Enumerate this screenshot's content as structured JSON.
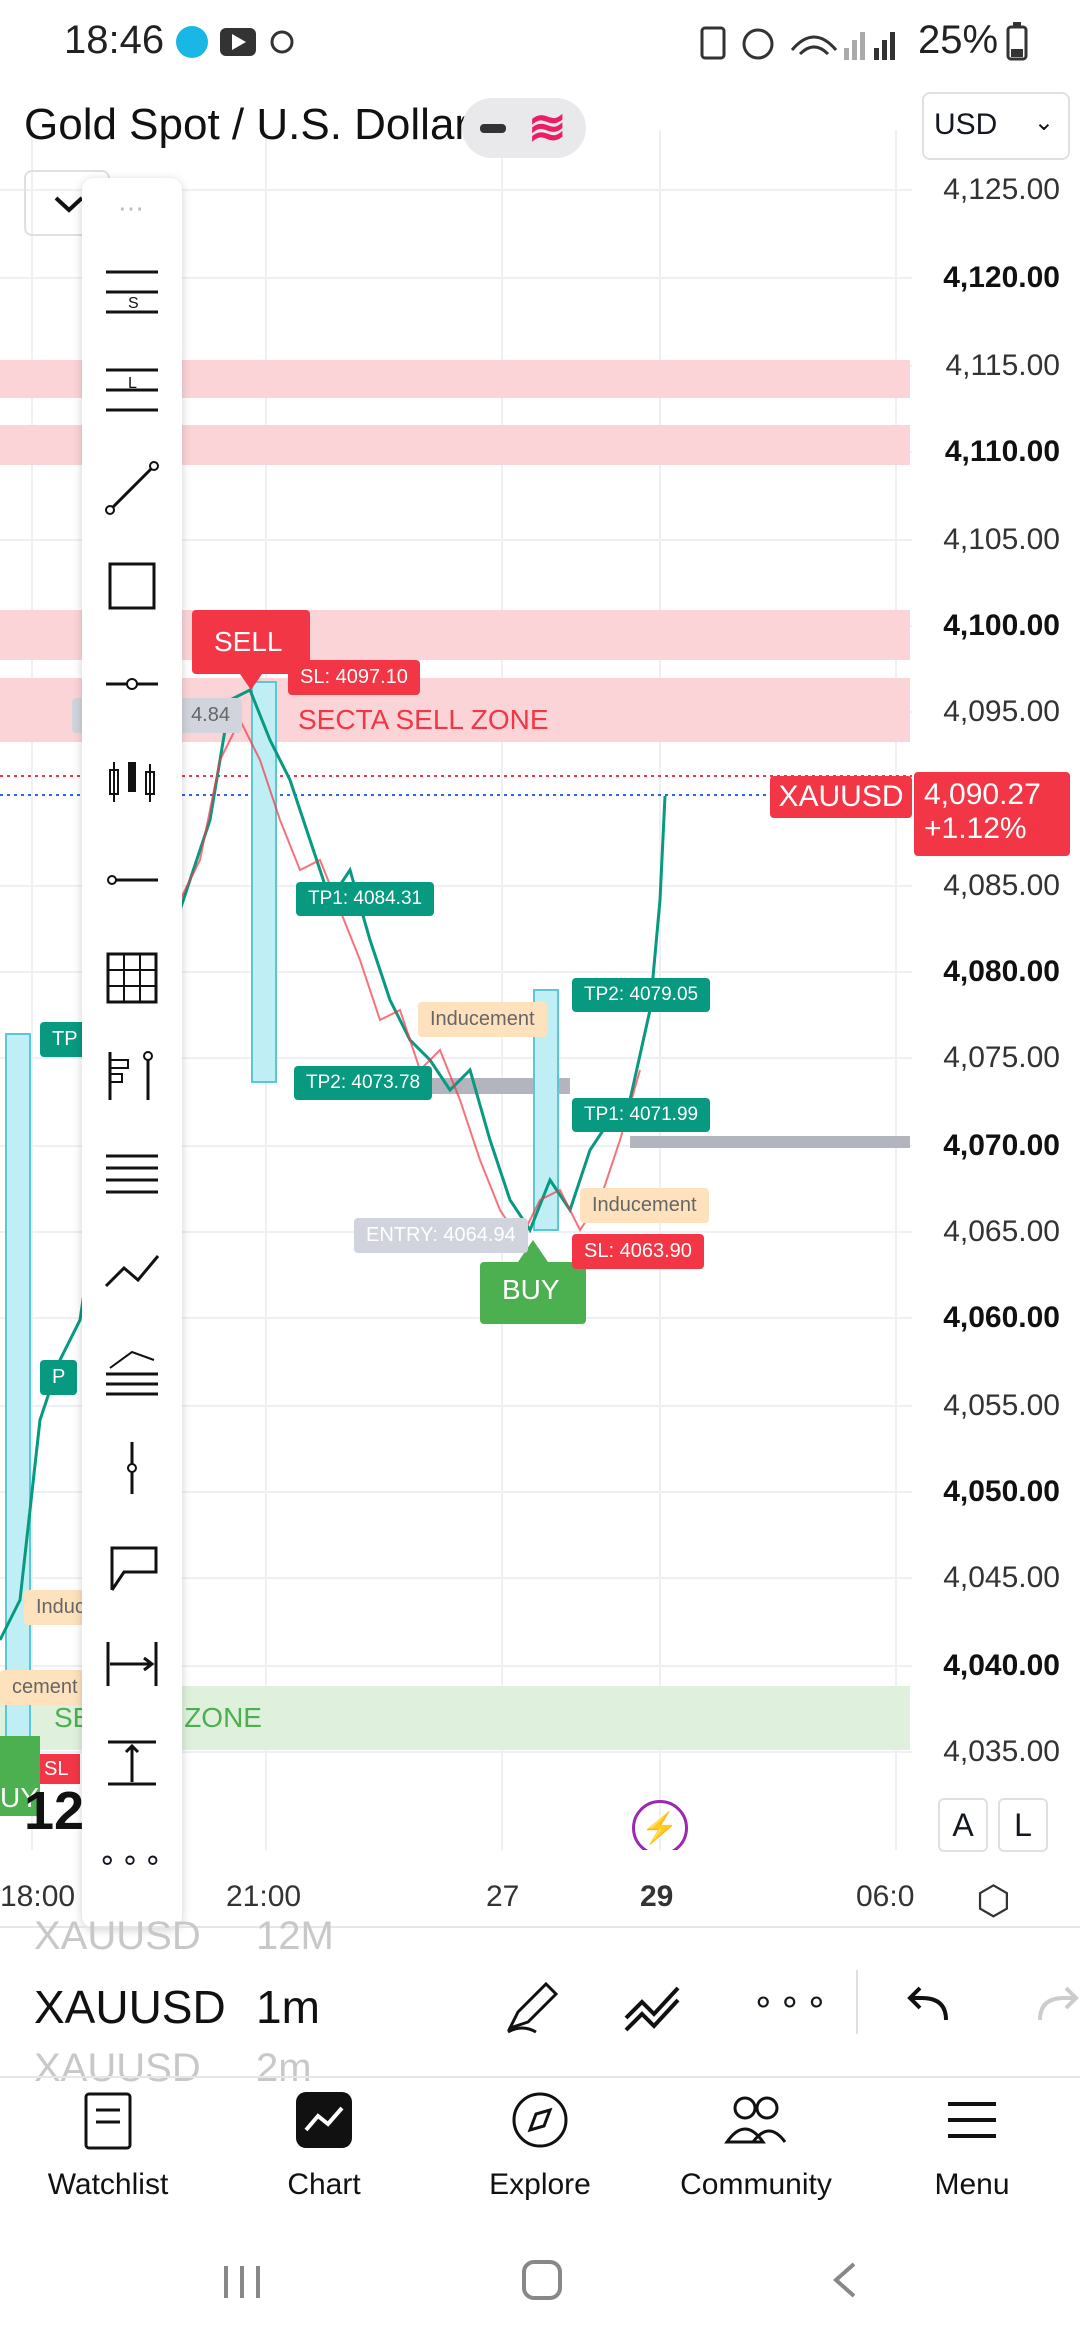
{
  "status_bar": {
    "time": "18:46",
    "battery": "25%"
  },
  "header": {
    "symbol_title": "Gold Spot / U.S. Dollar",
    "currency": "USD"
  },
  "price_axis": {
    "labels": [
      "4,125.00",
      "4,120.00",
      "4,115.00",
      "4,110.00",
      "4,105.00",
      "4,100.00",
      "4,095.00",
      "4,085.00",
      "4,080.00",
      "4,075.00",
      "4,070.00",
      "4,065.00",
      "4,060.00",
      "4,055.00",
      "4,050.00",
      "4,045.00",
      "4,040.00",
      "4,035.00"
    ],
    "current_price": "4,090.27",
    "change": "+1.12%",
    "ticker_tag": "XAUUSD",
    "scale_buttons": [
      "A",
      "L"
    ]
  },
  "time_axis": {
    "labels": [
      "18:00",
      "21:00",
      "27",
      "29",
      "06:0"
    ]
  },
  "chart_annotations": {
    "sell_label": "SELL",
    "buy_label": "BUY",
    "sl_sell": "SL: 4097.10",
    "tp1_sell": "TP1: 4084.31",
    "tp2_sell": "TP2: 4073.78",
    "sell_entry_partial": "4.84",
    "sell_zone": "SECTA SELL ZONE",
    "buy_zone": "SE      UY ZONE",
    "tp2_buy": "TP2: 4079.05",
    "tp1_buy": "TP1: 4071.99",
    "sl_buy": "SL: 4063.90",
    "entry_buy": "ENTRY: 4064.94",
    "inducement_1": "Inducement",
    "inducement_2": "Inducement",
    "inducement_left": "Induce",
    "inducement_left2": "cement",
    "left_tp": "TP",
    "left_p": "P",
    "left_sl": "SL",
    "left_buy": "UY",
    "left_big": "12"
  },
  "bottom_bar": {
    "symbol_prev": "XAUUSD",
    "interval_prev": "12M",
    "symbol": "XAUUSD",
    "interval": "1m",
    "symbol_next": "XAUUSD",
    "interval_next": "2m"
  },
  "nav": {
    "items": [
      {
        "label": "Watchlist"
      },
      {
        "label": "Chart"
      },
      {
        "label": "Explore"
      },
      {
        "label": "Community"
      },
      {
        "label": "Menu"
      }
    ]
  },
  "colors": {
    "red": "#f23645",
    "green": "#089981",
    "buy_green": "#4caf50",
    "cyan_zone": "#bfeff5",
    "sell_zone_bg": "#fbd4d8",
    "buy_zone_bg": "#dff1dd",
    "inducement_bg": "#fde2bd"
  }
}
